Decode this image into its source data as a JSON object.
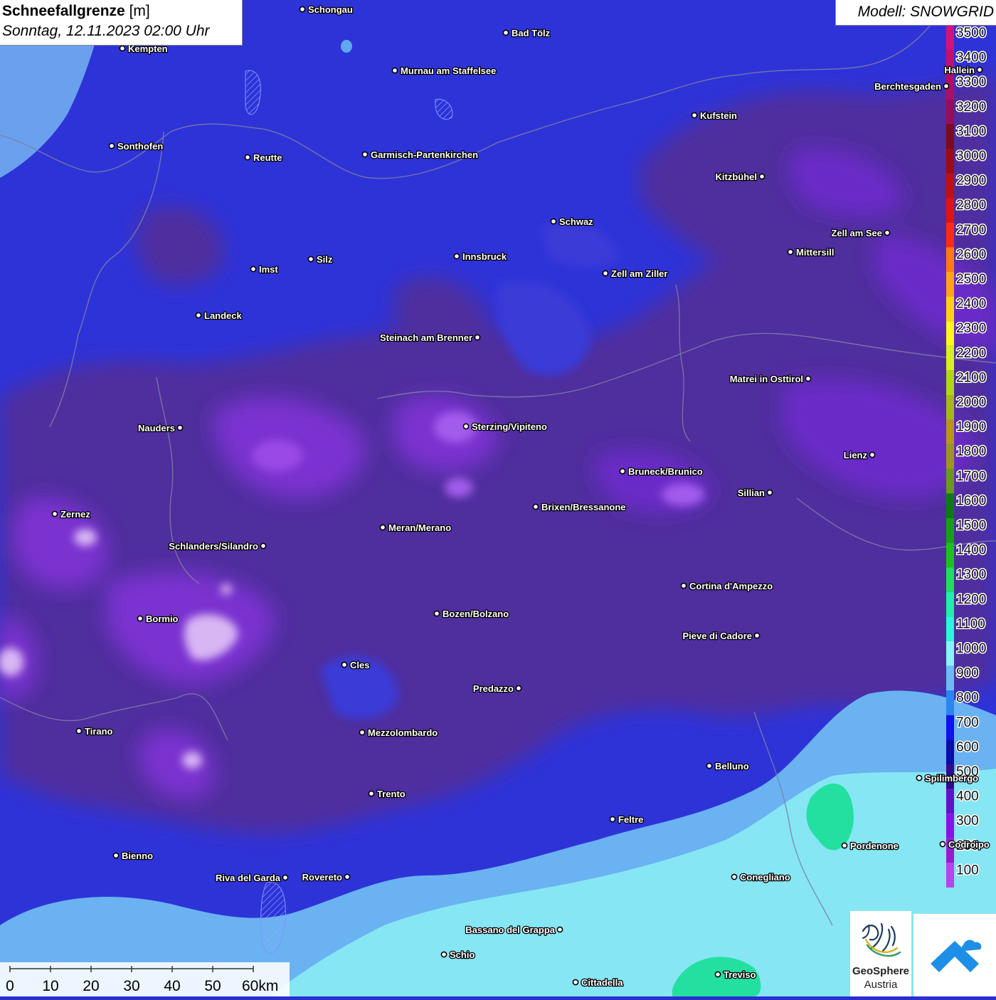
{
  "title": {
    "name": "Schneefallgrenze",
    "unit": "[m]",
    "datetime": "Sonntag, 12.11.2023 02:00 Uhr"
  },
  "model_label": "Modell: SNOWGRID",
  "legend": {
    "levels": [
      3500,
      3400,
      3300,
      3200,
      3100,
      3000,
      2900,
      2800,
      2700,
      2600,
      2500,
      2400,
      2300,
      2200,
      2100,
      2000,
      1900,
      1800,
      1700,
      1600,
      1500,
      1400,
      1300,
      1200,
      1100,
      1000,
      900,
      800,
      700,
      600,
      500,
      400,
      300,
      200,
      100
    ],
    "colors": [
      "#d4127a",
      "#c40f6f",
      "#b00e65",
      "#960d5a",
      "#7a0a1e",
      "#9c0b14",
      "#c00f10",
      "#e01212",
      "#ff2a12",
      "#ff7a10",
      "#ffa414",
      "#ffd212",
      "#fff61a",
      "#d8f01e",
      "#b2d614",
      "#a6b816",
      "#b8961a",
      "#9c9620",
      "#6a9a1c",
      "#0e7a14",
      "#16a014",
      "#1cc21c",
      "#1ee05a",
      "#1ef0a8",
      "#28f8d8",
      "#88f4f4",
      "#6cbcf4",
      "#2a86ee",
      "#1010f0",
      "#0c0ca8",
      "#320a8a",
      "#6212c8",
      "#8a12e8",
      "#9a1ad0",
      "#b844ee"
    ]
  },
  "cities": [
    {
      "name": "Schongau",
      "label_side": "right"
    },
    {
      "name": "Bad Tölz",
      "label_side": "right"
    },
    {
      "name": "Kempten",
      "label_side": "right"
    },
    {
      "name": "Murnau am Staffelsee",
      "label_side": "right"
    },
    {
      "name": "Hallein",
      "label_side": "left"
    },
    {
      "name": "Berchtesgaden",
      "label_side": "left"
    },
    {
      "name": "Kufstein",
      "label_side": "right"
    },
    {
      "name": "Sonthofen",
      "label_side": "right"
    },
    {
      "name": "Reutte",
      "label_side": "right"
    },
    {
      "name": "Garmisch-Partenkirchen",
      "label_side": "right"
    },
    {
      "name": "Kitzbühel",
      "label_side": "left"
    },
    {
      "name": "Schwaz",
      "label_side": "right"
    },
    {
      "name": "Zell am See",
      "label_side": "left"
    },
    {
      "name": "Mittersill",
      "label_side": "right"
    },
    {
      "name": "Innsbruck",
      "label_side": "right"
    },
    {
      "name": "Silz",
      "label_side": "right"
    },
    {
      "name": "Imst",
      "label_side": "right"
    },
    {
      "name": "Zell am Ziller",
      "label_side": "right"
    },
    {
      "name": "Landeck",
      "label_side": "right"
    },
    {
      "name": "Steinach am Brenner",
      "label_side": "left"
    },
    {
      "name": "Matrei in Osttirol",
      "label_side": "left"
    },
    {
      "name": "Nauders",
      "label_side": "left"
    },
    {
      "name": "Sterzing/Vipiteno",
      "label_side": "right"
    },
    {
      "name": "Lienz",
      "label_side": "left"
    },
    {
      "name": "Bruneck/Brunico",
      "label_side": "right"
    },
    {
      "name": "Sillian",
      "label_side": "left"
    },
    {
      "name": "Brixen/Bressanone",
      "label_side": "right"
    },
    {
      "name": "Zernez",
      "label_side": "right"
    },
    {
      "name": "Meran/Merano",
      "label_side": "right"
    },
    {
      "name": "Schlanders/Silandro",
      "label_side": "left"
    },
    {
      "name": "Cortina d'Ampezzo",
      "label_side": "right"
    },
    {
      "name": "Bozen/Bolzano",
      "label_side": "right"
    },
    {
      "name": "Bormio",
      "label_side": "right"
    },
    {
      "name": "Pieve di Cadore",
      "label_side": "left"
    },
    {
      "name": "Cles",
      "label_side": "right"
    },
    {
      "name": "Predazzo",
      "label_side": "left"
    },
    {
      "name": "Tirano",
      "label_side": "right"
    },
    {
      "name": "Mezzolombardo",
      "label_side": "right"
    },
    {
      "name": "Belluno",
      "label_side": "right"
    },
    {
      "name": "Spilimbergo",
      "label_side": "right"
    },
    {
      "name": "Trento",
      "label_side": "right"
    },
    {
      "name": "Feltre",
      "label_side": "right"
    },
    {
      "name": "Pordenone",
      "label_side": "right"
    },
    {
      "name": "Codroipo",
      "label_side": "right"
    },
    {
      "name": "Bienno",
      "label_side": "right"
    },
    {
      "name": "Riva del Garda",
      "label_side": "left"
    },
    {
      "name": "Rovereto",
      "label_side": "left"
    },
    {
      "name": "Conegliano",
      "label_side": "right"
    },
    {
      "name": "Bassano del Grappa",
      "label_side": "left"
    },
    {
      "name": "Schio",
      "label_side": "right"
    },
    {
      "name": "Treviso",
      "label_side": "right"
    },
    {
      "name": "Cittadella",
      "label_side": "right"
    }
  ],
  "scale_bar": {
    "ticks": [
      "0",
      "10",
      "20",
      "30",
      "40",
      "50",
      "60km"
    ]
  },
  "logos": {
    "geosphere_line1": "GeoSphere",
    "geosphere_line2": "Austria"
  }
}
